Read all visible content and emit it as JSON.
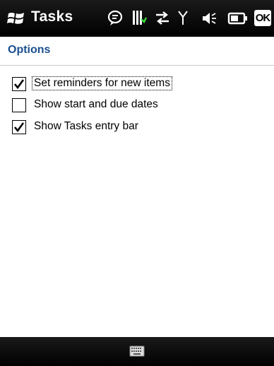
{
  "titlebar": {
    "app_title": "Tasks",
    "icons": [
      "windows-start-icon",
      "notification-bubble-icon",
      "battery-status-icon",
      "data-connection-icon",
      "signal-strength-icon",
      "speaker-volume-icon",
      "battery-icon"
    ],
    "ok_label": "OK"
  },
  "header": {
    "title": "Options"
  },
  "options": [
    {
      "label": "Set reminders for new items",
      "checked": true,
      "focused": true
    },
    {
      "label": "Show start and due dates",
      "checked": false,
      "focused": false
    },
    {
      "label": "Show Tasks entry bar",
      "checked": true,
      "focused": false
    }
  ],
  "bottombar": {
    "icons": [
      "keyboard-icon"
    ]
  },
  "colors": {
    "header_title": "#1b4f8f",
    "bar_background": "#000000",
    "page_background": "#ffffff"
  }
}
